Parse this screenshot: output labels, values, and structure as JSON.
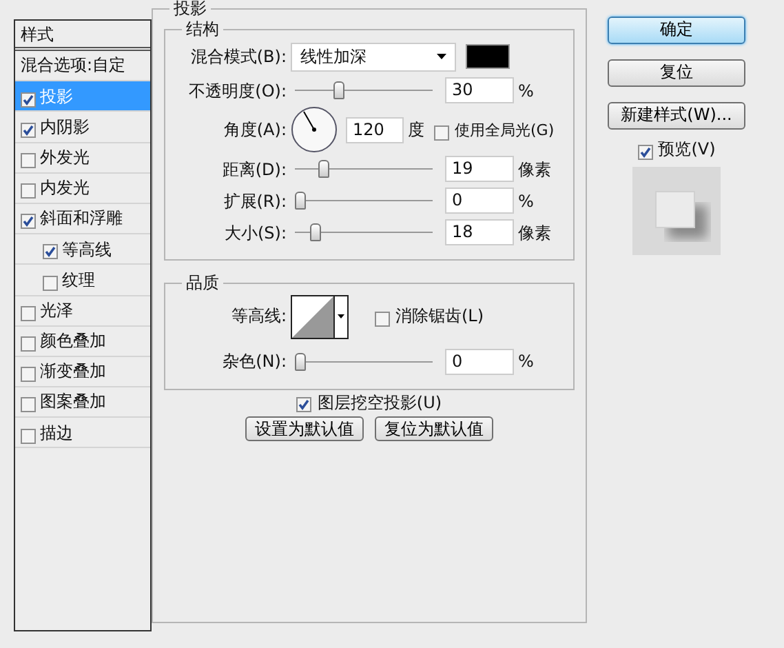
{
  "styles_panel": {
    "title": "样式",
    "blend_options": "混合选项:自定",
    "items": [
      {
        "label": "投影",
        "checked": true,
        "selected": true
      },
      {
        "label": "内阴影",
        "checked": true,
        "selected": false
      },
      {
        "label": "外发光",
        "checked": false,
        "selected": false
      },
      {
        "label": "内发光",
        "checked": false,
        "selected": false
      },
      {
        "label": "斜面和浮雕",
        "checked": true,
        "selected": false,
        "children": [
          {
            "label": "等高线",
            "checked": true,
            "selected": false
          },
          {
            "label": "纹理",
            "checked": false,
            "selected": false
          }
        ]
      },
      {
        "label": "光泽",
        "checked": false,
        "selected": false
      },
      {
        "label": "颜色叠加",
        "checked": false,
        "selected": false
      },
      {
        "label": "渐变叠加",
        "checked": false,
        "selected": false
      },
      {
        "label": "图案叠加",
        "checked": false,
        "selected": false
      },
      {
        "label": "描边",
        "checked": false,
        "selected": false
      }
    ]
  },
  "drop_shadow": {
    "title": "投影",
    "structure": {
      "title": "结构",
      "rows": [
        {
          "kind": "select",
          "label": "混合模式(B):",
          "value": "线性加深",
          "color": "#000000"
        },
        {
          "kind": "slider",
          "label": "不透明度(O):",
          "level": 0.3,
          "value": "30",
          "unit": "%"
        },
        {
          "kind": "angle",
          "label": "角度(A):",
          "value": "120",
          "unit": "度",
          "global_light": {
            "label": "使用全局光(G)",
            "checked": false
          }
        },
        {
          "kind": "slider",
          "label": "距离(D):",
          "level": 0.19,
          "value": "19",
          "unit": "像素"
        },
        {
          "kind": "slider",
          "label": "扩展(R):",
          "level": 0,
          "value": "0",
          "unit": "%"
        },
        {
          "kind": "slider",
          "label": "大小(S):",
          "level": 0.12,
          "value": "18",
          "unit": "像素"
        }
      ]
    },
    "quality": {
      "title": "品质",
      "contour": {
        "label": "等高线:"
      },
      "anti_alias": {
        "label": "消除锯齿(L)",
        "checked": false
      },
      "noise": {
        "label": "杂色(N):",
        "level": 0,
        "value": "0",
        "unit": "%"
      }
    },
    "knockout": {
      "label": "图层挖空投影(U)",
      "checked": true
    },
    "buttons": [
      "设置为默认值",
      "复位为默认值"
    ]
  },
  "actions": [
    {
      "label": "确定",
      "default": true
    },
    {
      "label": "复位",
      "default": false
    },
    {
      "label": "新建样式(W)...",
      "default": false
    }
  ],
  "preview": {
    "label": "预览(V)",
    "checked": true
  }
}
